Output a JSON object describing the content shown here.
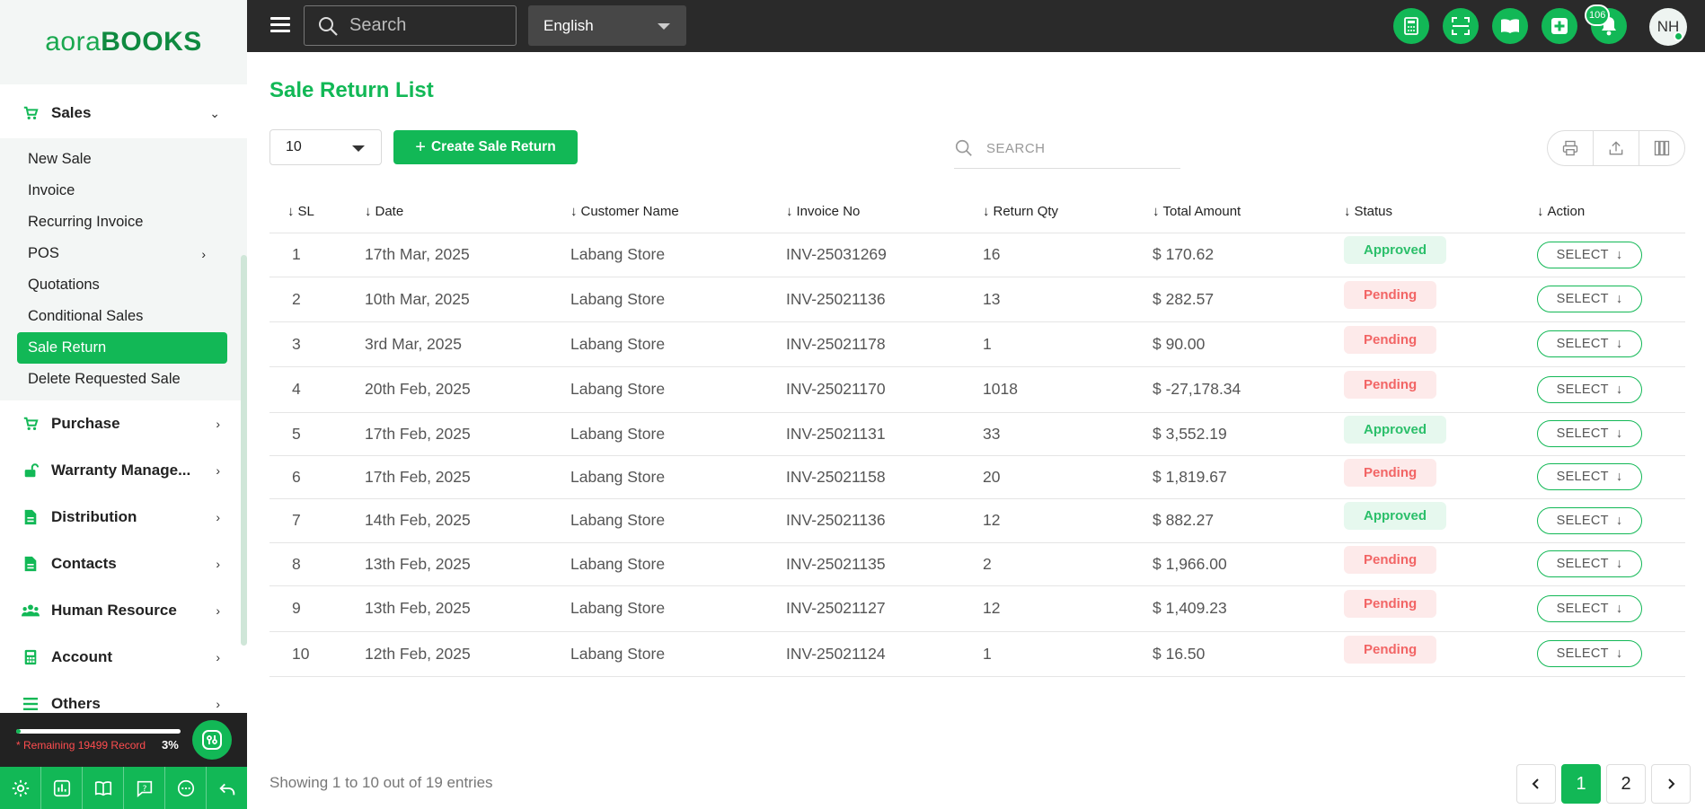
{
  "brand": {
    "logo_left": "aora",
    "logo_right": "BOOKS"
  },
  "sidebar": {
    "sales": {
      "label": "Sales",
      "items": [
        {
          "label": "New Sale"
        },
        {
          "label": "Invoice"
        },
        {
          "label": "Recurring Invoice"
        },
        {
          "label": "POS"
        },
        {
          "label": "Quotations"
        },
        {
          "label": "Conditional Sales"
        },
        {
          "label": "Sale Return"
        },
        {
          "label": "Delete Requested Sale"
        }
      ]
    },
    "sections": [
      {
        "label": "Purchase",
        "icon": "cart-icon"
      },
      {
        "label": "Warranty Manage...",
        "icon": "unlock-icon"
      },
      {
        "label": "Distribution",
        "icon": "file-icon"
      },
      {
        "label": "Contacts",
        "icon": "file-icon"
      },
      {
        "label": "Human Resource",
        "icon": "users-icon"
      },
      {
        "label": "Account",
        "icon": "calculator-icon"
      },
      {
        "label": "Others",
        "icon": "list-icon"
      }
    ],
    "footer": {
      "remaining": "* Remaining 19499 Record",
      "percent": "3%",
      "progress_fraction": 0.03
    }
  },
  "topbar": {
    "search_placeholder": "Search",
    "language": "English",
    "notification_count": "106",
    "avatar_initials": "NH"
  },
  "main": {
    "title": "Sale Return List",
    "per_page": "10",
    "create_label": "Create Sale Return",
    "search_placeholder": "SEARCH",
    "columns": [
      "SL",
      "Date",
      "Customer Name",
      "Invoice No",
      "Return Qty",
      "Total Amount",
      "Status",
      "Action"
    ],
    "select_label": "SELECT",
    "rows": [
      {
        "sl": "1",
        "date": "17th Mar, 2025",
        "customer": "Labang Store",
        "invoice": "INV-25031269",
        "qty": "16",
        "amount": "$ 170.62",
        "status": "Approved"
      },
      {
        "sl": "2",
        "date": "10th Mar, 2025",
        "customer": "Labang Store",
        "invoice": "INV-25021136",
        "qty": "13",
        "amount": "$ 282.57",
        "status": "Pending"
      },
      {
        "sl": "3",
        "date": "3rd Mar, 2025",
        "customer": "Labang Store",
        "invoice": "INV-25021178",
        "qty": "1",
        "amount": "$ 90.00",
        "status": "Pending"
      },
      {
        "sl": "4",
        "date": "20th Feb, 2025",
        "customer": "Labang Store",
        "invoice": "INV-25021170",
        "qty": "1018",
        "amount": "$ -27,178.34",
        "status": "Pending"
      },
      {
        "sl": "5",
        "date": "17th Feb, 2025",
        "customer": "Labang Store",
        "invoice": "INV-25021131",
        "qty": "33",
        "amount": "$ 3,552.19",
        "status": "Approved"
      },
      {
        "sl": "6",
        "date": "17th Feb, 2025",
        "customer": "Labang Store",
        "invoice": "INV-25021158",
        "qty": "20",
        "amount": "$ 1,819.67",
        "status": "Pending"
      },
      {
        "sl": "7",
        "date": "14th Feb, 2025",
        "customer": "Labang Store",
        "invoice": "INV-25021136",
        "qty": "12",
        "amount": "$ 882.27",
        "status": "Approved"
      },
      {
        "sl": "8",
        "date": "13th Feb, 2025",
        "customer": "Labang Store",
        "invoice": "INV-25021135",
        "qty": "2",
        "amount": "$ 1,966.00",
        "status": "Pending"
      },
      {
        "sl": "9",
        "date": "13th Feb, 2025",
        "customer": "Labang Store",
        "invoice": "INV-25021127",
        "qty": "12",
        "amount": "$ 1,409.23",
        "status": "Pending"
      },
      {
        "sl": "10",
        "date": "12th Feb, 2025",
        "customer": "Labang Store",
        "invoice": "INV-25021124",
        "qty": "1",
        "amount": "$ 16.50",
        "status": "Pending"
      }
    ],
    "showing": "Showing 1 to 10 out of 19 entries",
    "pages": [
      "1",
      "2"
    ]
  },
  "colors": {
    "accent": "#12b856",
    "topbar": "#2a2a2a",
    "approved": "#2bbf6a",
    "pending": "#f26565"
  }
}
